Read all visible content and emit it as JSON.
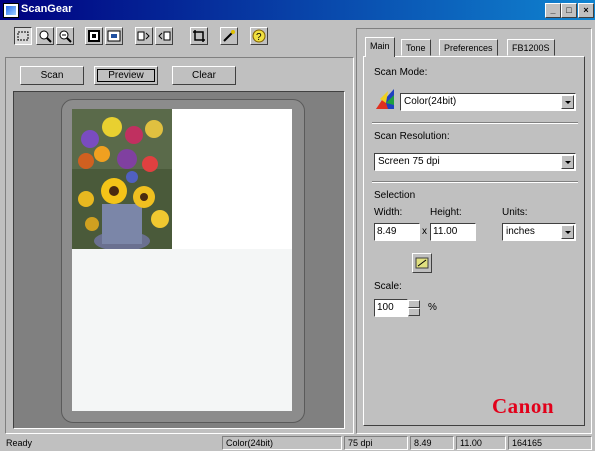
{
  "window": {
    "title": "ScanGear",
    "minimize": "_",
    "maximize": "□",
    "close": "×"
  },
  "toolbar": {
    "buttons": [
      "select-icon",
      "zoom-in-icon",
      "zoom-out-icon",
      "auto-crop-icon",
      "fit-icon",
      "rotate-left-icon",
      "rotate-right-icon",
      "crop-icon",
      "magic-wand-icon",
      "help-icon"
    ]
  },
  "left_panel": {
    "scan_label": "Scan",
    "preview_label": "Preview",
    "clear_label": "Clear"
  },
  "tabs": [
    "Main",
    "Tone",
    "Preferences",
    "FB1200S"
  ],
  "main_tab": {
    "scan_mode_label": "Scan Mode:",
    "scan_mode_value": "Color(24bit)",
    "scan_resolution_label": "Scan Resolution:",
    "scan_resolution_value": "Screen 75 dpi",
    "selection_label": "Selection",
    "width_label": "Width:",
    "width_value": "8.49",
    "x_separator": "x",
    "height_label": "Height:",
    "height_value": "11.00",
    "units_label": "Units:",
    "units_value": "inches",
    "scale_label": "Scale:",
    "scale_value": "100",
    "percent_label": "%",
    "brand": "Canon"
  },
  "statusbar": {
    "status": "Ready",
    "mode": "Color(24bit)",
    "dpi": "75 dpi",
    "width": "8.49",
    "height": "11.00",
    "size": "164165"
  }
}
